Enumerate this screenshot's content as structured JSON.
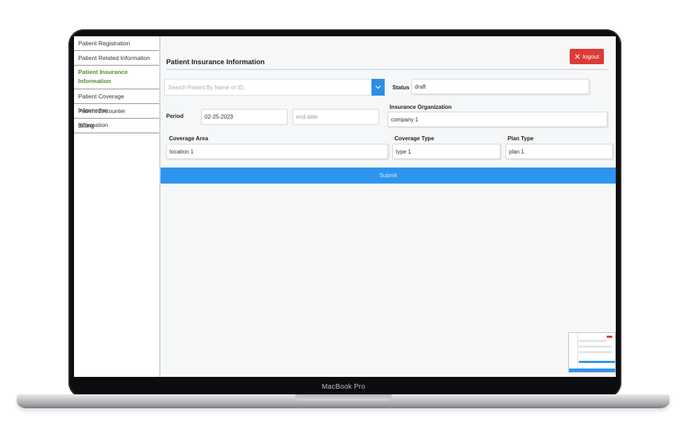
{
  "device": {
    "brand": "MacBook Pro"
  },
  "sidebar": {
    "items": [
      {
        "label": "Patient Registration"
      },
      {
        "label": "Patient Related Information"
      },
      {
        "label": "Patient Insurance Information",
        "active": true
      },
      {
        "label": "Patient Coverage Information"
      },
      {
        "label": "Patient Encounter Information"
      },
      {
        "label": "Billing"
      }
    ]
  },
  "header": {
    "title": "Patient Insurance Information",
    "logout_label": "logout"
  },
  "form": {
    "search": {
      "placeholder": "Search Patient By Name or ID..",
      "icon": "chevron-down-icon"
    },
    "status": {
      "label": "Status",
      "value": "draft"
    },
    "period": {
      "label": "Period",
      "start_value": "02-25-2023",
      "end_placeholder": "end date"
    },
    "insurance_org": {
      "label": "Insurance Organization",
      "value": "company 1"
    },
    "coverage_area": {
      "label": "Coverage Area",
      "value": "location 1"
    },
    "coverage_type": {
      "label": "Coverage Type",
      "value": "type 1"
    },
    "plan_type": {
      "label": "Plan Type",
      "value": "plan 1"
    },
    "submit_label": "Submit"
  },
  "colors": {
    "accent_blue": "#2d95ee",
    "logout_red": "#dc3b36",
    "active_green": "#4f8a2b"
  }
}
